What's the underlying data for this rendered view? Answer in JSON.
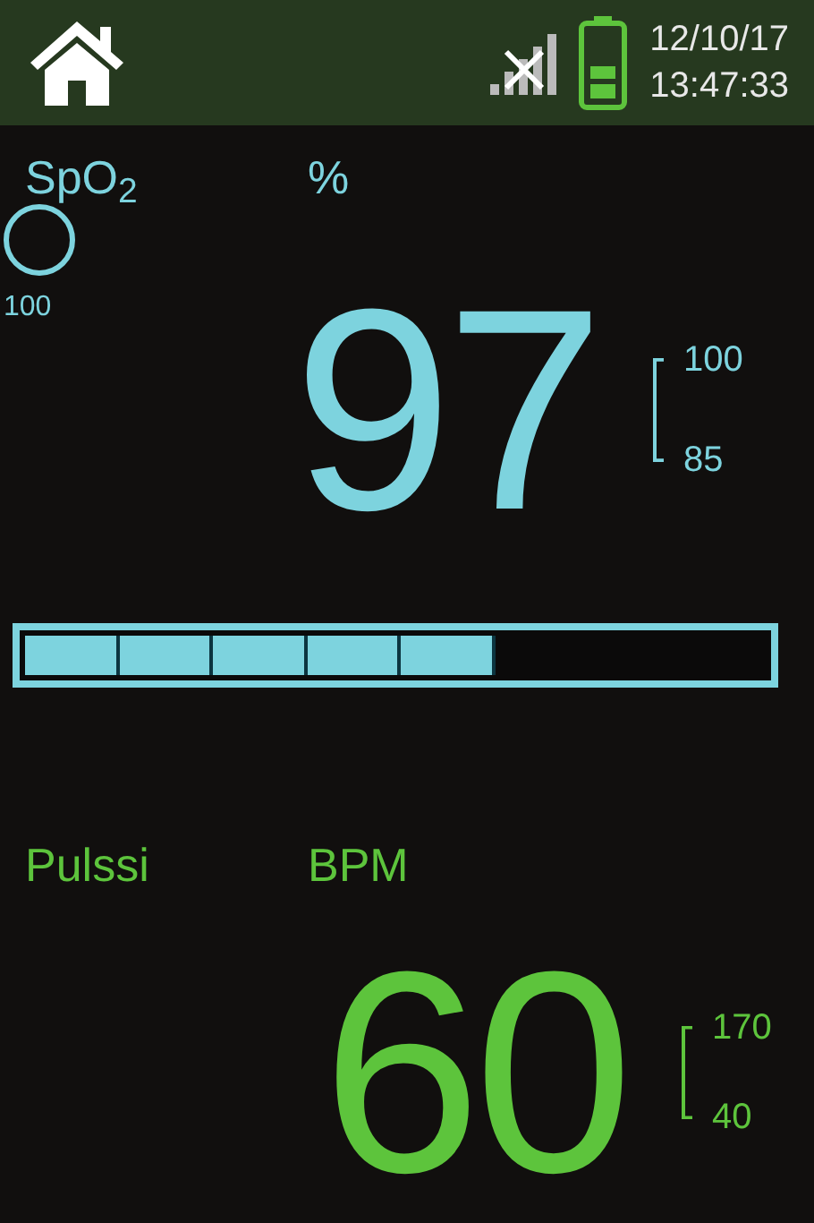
{
  "header": {
    "date": "12/10/17",
    "time": "13:47:33"
  },
  "spo2": {
    "label": "SpO$_{2}$",
    "unit": "%",
    "indicator_value": "100",
    "value": "97",
    "range_high": "100",
    "range_low": "85"
  },
  "perfusion_bar": {
    "segments": [
      {
        "lit": true
      },
      {
        "lit": true
      },
      {
        "lit": true
      },
      {
        "lit": true
      },
      {
        "lit": true
      },
      {
        "lit": false
      },
      {
        "lit": false
      },
      {
        "lit": false
      }
    ]
  },
  "pulse": {
    "label": "Pulssi",
    "unit": "BPM",
    "value": "60",
    "range_high": "170",
    "range_low": "40"
  }
}
